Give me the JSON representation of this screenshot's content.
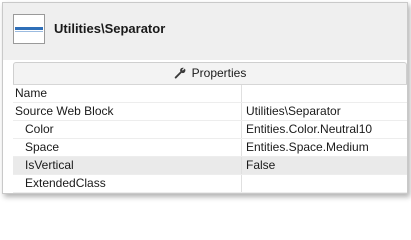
{
  "header": {
    "title": "Utilities\\Separator",
    "icon": "separator-icon"
  },
  "tab": {
    "label": "Properties",
    "icon": "wrench-icon"
  },
  "properties": [
    {
      "name": "Name",
      "value": ""
    },
    {
      "name": "Source Web Block",
      "value": "Utilities\\Separator"
    },
    {
      "name": "Color",
      "value": "Entities.Color.Neutral10"
    },
    {
      "name": "Space",
      "value": "Entities.Space.Medium"
    },
    {
      "name": "IsVertical",
      "value": "False"
    },
    {
      "name": "ExtendedClass",
      "value": ""
    }
  ],
  "colors": {
    "separator_line": "#2f6fb8",
    "header_bg": "#efefef",
    "selected_row": "#eaeaea"
  }
}
